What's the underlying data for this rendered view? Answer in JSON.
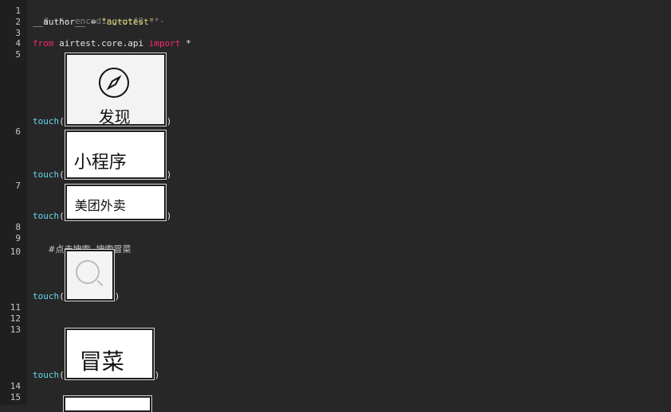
{
  "lines": {
    "l1": "# -*- encoding=utf8 -*-",
    "l2_var": "__author__",
    "l2_eq": " = ",
    "l2_str": "\"autotest\"",
    "l4_from": "from",
    "l4_mod": " airtest.core.api ",
    "l4_import": "import",
    "l4_star": " *",
    "l9_comment": "#点击搜索, 搜索冒菜"
  },
  "line_numbers": [
    "1",
    "2",
    "3",
    "4",
    "5",
    "6",
    "7",
    "8",
    "9",
    "10",
    "11",
    "12",
    "13",
    "14",
    "15"
  ],
  "touch_label": "touch",
  "paren_open": "(",
  "paren_close": ")",
  "images": {
    "discover": "发现",
    "mini_program": "小程序",
    "meituan": "美团外卖",
    "maocai": "冒菜"
  },
  "icons": {
    "discover_icon": "compass-icon",
    "search_icon": "search-icon"
  },
  "colors": {
    "background": "#272727",
    "keyword": "#f92672",
    "function": "#66d9ef",
    "string": "#e6db74",
    "comment": "#7f7f7f"
  }
}
